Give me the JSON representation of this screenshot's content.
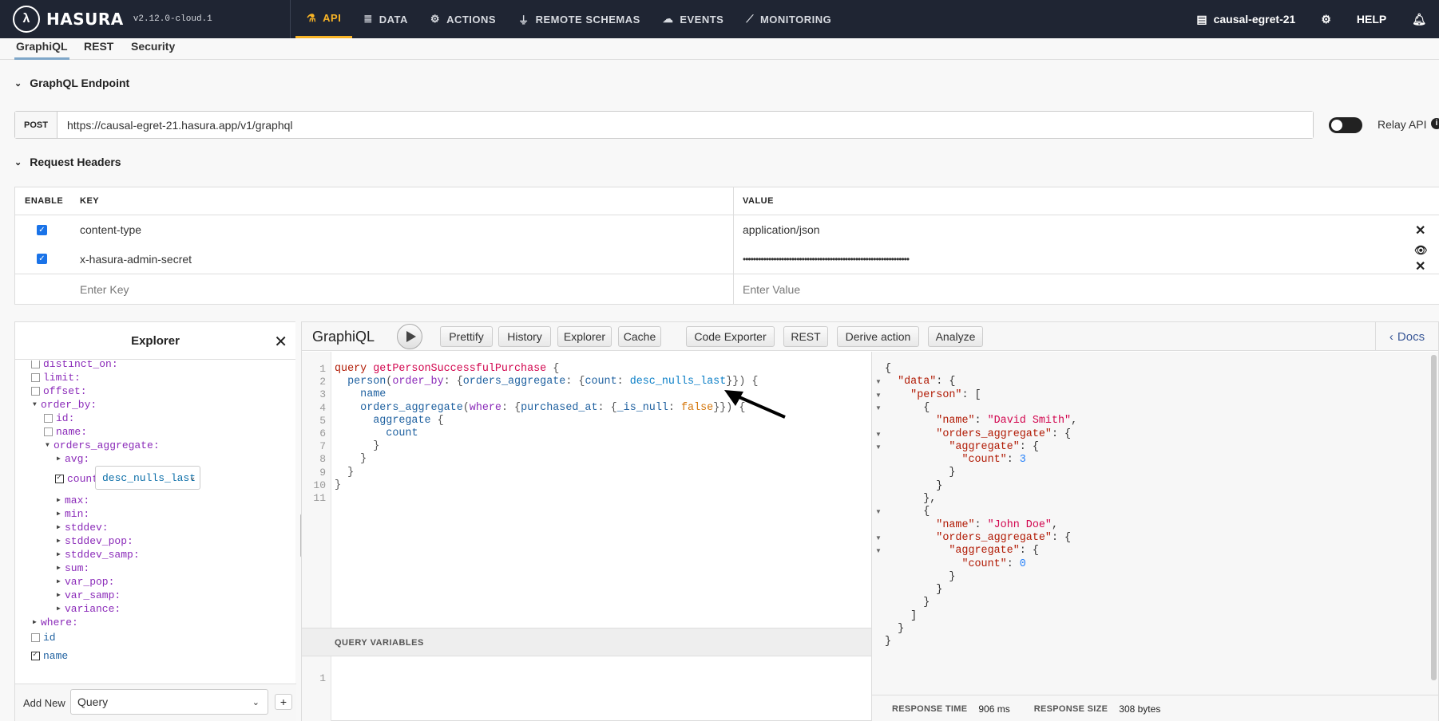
{
  "brand": {
    "logo": "λ",
    "name": "HASURA",
    "version": "v2.12.0-cloud.1"
  },
  "nav": [
    {
      "label": "API",
      "icon": "flask-icon"
    },
    {
      "label": "DATA",
      "icon": "database-icon"
    },
    {
      "label": "ACTIONS",
      "icon": "gears-icon"
    },
    {
      "label": "REMOTE SCHEMAS",
      "icon": "plug-icon"
    },
    {
      "label": "EVENTS",
      "icon": "cloud-icon"
    },
    {
      "label": "MONITORING",
      "icon": "chart-icon"
    }
  ],
  "right_nav": {
    "project": "causal-egret-21",
    "help": "HELP"
  },
  "subtabs": [
    "GraphiQL",
    "REST",
    "Security"
  ],
  "endpoint": {
    "heading": "GraphQL Endpoint",
    "method": "POST",
    "url": "https://causal-egret-21.hasura.app/v1/graphql",
    "relay_label": "Relay API"
  },
  "headers": {
    "heading": "Request Headers",
    "col_enable": "ENABLE",
    "col_key": "KEY",
    "col_value": "VALUE",
    "rows": [
      {
        "key": "content-type",
        "value": "application/json"
      },
      {
        "key": "x-hasura-admin-secret",
        "value": "•••••••••••••••••••••••••••••••••••••••••••••••••••••••••••••••••"
      }
    ],
    "key_placeholder": "Enter Key",
    "value_placeholder": "Enter Value"
  },
  "explorer": {
    "title": "Explorer",
    "select_value": "desc_nulls_last",
    "add_new": "Add New",
    "query_type": "Query",
    "plus": "+",
    "tree": [
      "distinct_on:",
      "limit:",
      "offset:",
      "order_by:",
      "id:",
      "name:",
      "orders_aggregate:",
      "avg:",
      "count:",
      "max:",
      "min:",
      "stddev:",
      "stddev_pop:",
      "stddev_samp:",
      "sum:",
      "var_pop:",
      "var_samp:",
      "variance:",
      "where:",
      "id",
      "name"
    ]
  },
  "graphiql": {
    "title": "GraphiQL",
    "buttons": [
      "Prettify",
      "History",
      "Explorer",
      "Cache",
      "Code Exporter",
      "REST",
      "Derive action",
      "Analyze"
    ],
    "docs": "Docs",
    "query_vars": "QUERY VARIABLES",
    "qv_line": "1",
    "code": [
      [
        "query ",
        "getPersonSuccessfulPurchase",
        " {"
      ],
      [
        "  ",
        "person",
        "(",
        "order_by",
        ": {",
        "orders_aggregate",
        ": {",
        "count",
        ": ",
        "desc_nulls_last",
        "}}) {"
      ],
      [
        "    ",
        "name"
      ],
      [
        "    ",
        "orders_aggregate",
        "(",
        "where",
        ": {",
        "purchased_at",
        ": {",
        "_is_null",
        ": ",
        "false",
        "}}) {"
      ],
      [
        "      ",
        "aggregate",
        " {"
      ],
      [
        "        ",
        "count"
      ],
      [
        "      ",
        "}"
      ],
      [
        "    ",
        "}"
      ],
      [
        "  ",
        "}"
      ],
      [
        "}"
      ],
      [
        ""
      ]
    ],
    "response_time_label": "RESPONSE TIME",
    "response_time": "906 ms",
    "response_size_label": "RESPONSE SIZE",
    "response_size": "308 bytes"
  },
  "result_lines": [
    "{",
    "  \"data\": {",
    "    \"person\": [",
    "      {",
    "        \"name\": \"David Smith\",",
    "        \"orders_aggregate\": {",
    "          \"aggregate\": {",
    "            \"count\": 3",
    "          }",
    "        }",
    "      },",
    "      {",
    "        \"name\": \"John Doe\",",
    "        \"orders_aggregate\": {",
    "          \"aggregate\": {",
    "            \"count\": 0",
    "          }",
    "        }",
    "      }",
    "    ]",
    "  }",
    "}"
  ]
}
